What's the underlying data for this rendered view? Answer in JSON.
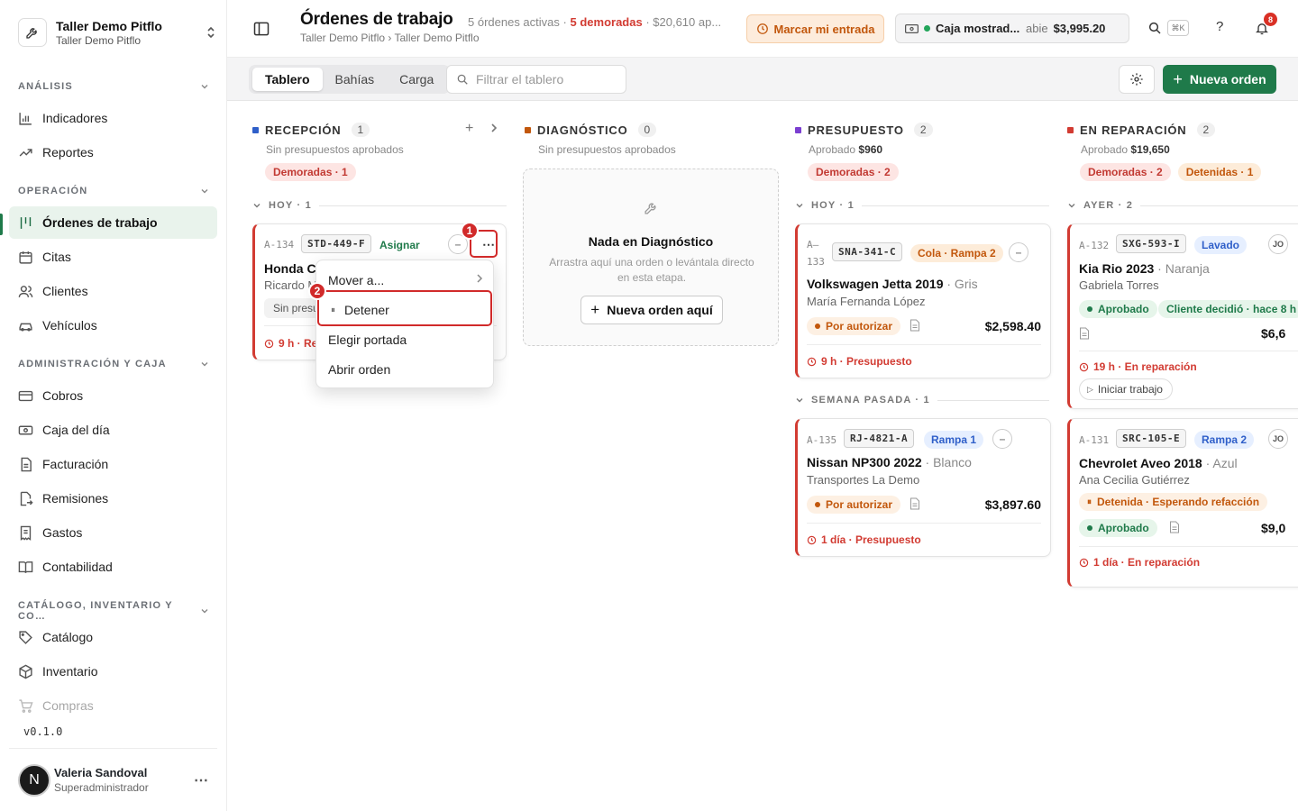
{
  "org": {
    "name": "Taller Demo Pitflo",
    "subtitle": "Taller Demo Pitflo"
  },
  "sidebar": {
    "sections": [
      {
        "label": "ANÁLISIS",
        "items": [
          "Indicadores",
          "Reportes"
        ]
      },
      {
        "label": "OPERACIÓN",
        "items": [
          "Órdenes de trabajo",
          "Citas",
          "Clientes",
          "Vehículos"
        ]
      },
      {
        "label": "ADMINISTRACIÓN Y CAJA",
        "items": [
          "Cobros",
          "Caja del día",
          "Facturación",
          "Remisiones",
          "Gastos",
          "Contabilidad"
        ]
      },
      {
        "label": "CATÁLOGO, INVENTARIO Y CO…",
        "items": [
          "Catálogo",
          "Inventario",
          "Compras"
        ]
      }
    ],
    "active_item": "Órdenes de trabajo",
    "version": "v0.1.0",
    "user": {
      "initial": "N",
      "name": "Valeria Sandoval",
      "role": "Superadministrador"
    }
  },
  "header": {
    "title": "Órdenes de trabajo",
    "summary_active": "5 órdenes activas",
    "summary_sep": "·",
    "summary_late": "5 demoradas",
    "summary_amount": "· $20,610 ap...",
    "breadcrumb": "Taller Demo Pitflo › Taller Demo Pitflo",
    "entry_button": "Marcar mi entrada",
    "cash": {
      "label": "Caja mostrad...",
      "status": "abie",
      "amount": "$3,995.20"
    },
    "shortcut": "⌘K",
    "notifications": "8"
  },
  "toolbar": {
    "tabs": [
      "Tablero",
      "Bahías",
      "Carga"
    ],
    "active_tab": "Tablero",
    "filter_placeholder": "Filtrar el tablero",
    "new_order": "Nueva orden"
  },
  "columns": {
    "recepcion": {
      "name": "RECEPCIÓN",
      "count": "1",
      "color": "#2f5fc9",
      "sub": "Sin presupuestos aprobados",
      "tags": [
        "Demoradas · 1"
      ],
      "group": "HOY · 1",
      "card": {
        "code": "A-134",
        "plate": "STD-449-F",
        "assign": "Asignar",
        "model": "Honda Cl",
        "client": "Ricardo M",
        "status": "Sin presu",
        "footer": "9 h · Rec"
      }
    },
    "diagnostico": {
      "name": "DIAGNÓSTICO",
      "count": "0",
      "color": "#c2570c",
      "sub": "Sin presupuestos aprobados",
      "empty_title": "Nada en Diagnóstico",
      "empty_desc": "Arrastra aquí una orden o levántala directo en esta etapa.",
      "empty_button": "Nueva orden aquí"
    },
    "presupuesto": {
      "name": "PRESUPUESTO",
      "count": "2",
      "color": "#7b3fd1",
      "sub_label": "Aprobado",
      "sub_value": "$960",
      "tags": [
        "Demoradas · 2"
      ],
      "groups": [
        "HOY · 1",
        "SEMANA PASADA · 1"
      ],
      "cards": [
        {
          "code_a": "A–",
          "code_b": "133",
          "plate": "SNA-341-C",
          "bay": "Cola · Rampa 2",
          "model": "Volkswagen Jetta 2019",
          "color_name": "· Gris",
          "client": "María Fernanda López",
          "status": "Por autorizar",
          "price": "$2,598.40",
          "footer": "9 h · Presupuesto"
        },
        {
          "code": "A-135",
          "plate": "RJ-4821-A",
          "bay": "Rampa 1",
          "model": "Nissan NP300 2022",
          "color_name": "· Blanco",
          "client": "Transportes La Demo",
          "status": "Por autorizar",
          "price": "$3,897.60",
          "footer": "1 día · Presupuesto"
        }
      ]
    },
    "reparacion": {
      "name": "EN REPARACIÓN",
      "count": "2",
      "color": "#d23b32",
      "sub_label": "Aprobado",
      "sub_value": "$19,650",
      "tags": [
        "Demoradas · 2",
        "Detenidas · 1"
      ],
      "group": "AYER · 2",
      "cards": [
        {
          "code": "A-132",
          "plate": "SXG-593-I",
          "bay": "Lavado",
          "tech": "JO",
          "model": "Kia Rio 2023",
          "color_name": "· Naranja",
          "client": "Gabriela Torres",
          "status": "Aprobado",
          "decision": "Cliente decidió · hace 8 h",
          "price": "$6,6",
          "footer": "19 h · En reparación",
          "action": "Iniciar trabajo"
        },
        {
          "code": "A-131",
          "plate": "SRC-105-E",
          "bay": "Rampa 2",
          "tech": "JO",
          "model": "Chevrolet Aveo 2018",
          "color_name": "· Azul",
          "client": "Ana Cecilia Gutiérrez",
          "hold": "Detenida · Esperando refacción",
          "status": "Aprobado",
          "price": "$9,0",
          "footer": "1 día · En reparación"
        }
      ]
    }
  },
  "context_menu": {
    "items": [
      "Mover a...",
      "Detener",
      "Elegir portada",
      "Abrir orden"
    ]
  },
  "markers": [
    "1",
    "2"
  ]
}
